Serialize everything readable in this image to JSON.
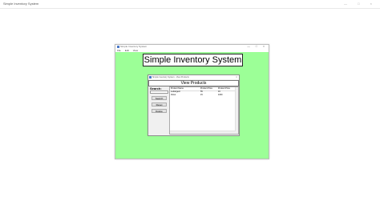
{
  "browser": {
    "tab_title": "Simple Inventory System",
    "controls": [
      "—",
      "□",
      "×"
    ]
  },
  "app": {
    "window_title": "Simple Inventory System",
    "controls": [
      "—",
      "□",
      "×"
    ],
    "menu": [
      "File",
      "Edit",
      "View"
    ],
    "heading": "Simple Inventory System",
    "content_bg": "#9cff97"
  },
  "dialog": {
    "title": "Simple Inventory System - View Products",
    "close": "×",
    "heading": "View Products",
    "search_label": "Search:",
    "search_value": "",
    "buttons": {
      "search": "Search",
      "reset": "Reset",
      "delete": "Delete"
    },
    "table": {
      "columns": [
        "Product Name",
        "Product Price",
        "Product Price"
      ],
      "rows": [
        [
          "Ludiargent",
          "55",
          "16"
        ],
        [
          "Victor",
          "15",
          "1000"
        ]
      ]
    }
  }
}
